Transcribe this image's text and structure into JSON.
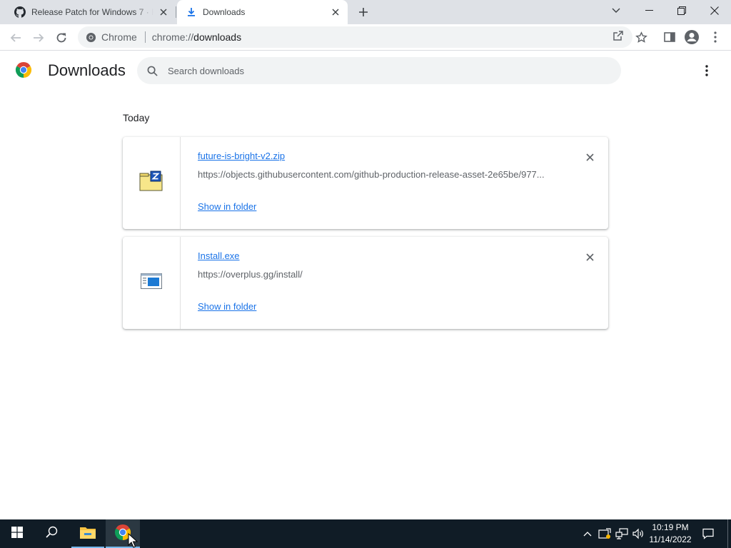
{
  "browser": {
    "tabs": [
      {
        "title": "Release Patch for Windows 7 · Rc",
        "favicon": "github-icon",
        "active": false
      },
      {
        "title": "Downloads",
        "favicon": "download-icon",
        "active": true
      }
    ],
    "omnibox": {
      "chip_label": "Chrome",
      "url_scheme": "chrome://",
      "url_host": "downloads"
    }
  },
  "page": {
    "title": "Downloads",
    "search_placeholder": "Search downloads",
    "date_header": "Today",
    "downloads": [
      {
        "file_name": "future-is-bright-v2.zip",
        "url": "https://objects.githubusercontent.com/github-production-release-asset-2e65be/977...",
        "action": "Show in folder",
        "icon": "zip-file-icon"
      },
      {
        "file_name": "Install.exe",
        "url": "https://overplus.gg/install/",
        "action": "Show in folder",
        "icon": "exe-file-icon"
      }
    ]
  },
  "taskbar": {
    "time": "10:19 PM",
    "date": "11/14/2022"
  },
  "colors": {
    "link": "#1a73e8",
    "taskbar": "#101c26",
    "tabstrip": "#dee1e6"
  }
}
